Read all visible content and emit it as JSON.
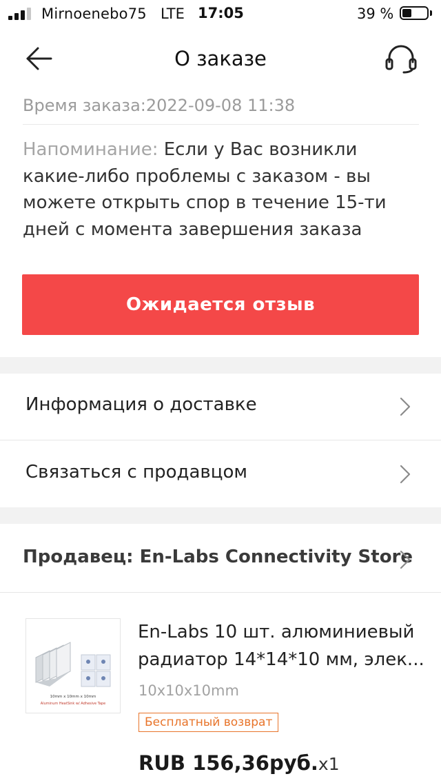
{
  "status_bar": {
    "carrier": "Mirnoenebo75",
    "network": "LTE",
    "time": "17:05",
    "battery_percent": "39 %",
    "battery_level": 0.39,
    "signal_bars_active": 3,
    "signal_bars_total": 4
  },
  "header": {
    "title": "О заказе",
    "back_icon": "arrow-left-icon",
    "support_icon": "headset-icon"
  },
  "order": {
    "time_text": "Время заказа:2022-09-08 11:38",
    "reminder_label": "Напоминание: ",
    "reminder_lines": [
      "Если у Вас возникли",
      "какие-либо проблемы с заказом - вы",
      "можете открыть спор в течение 15-ти",
      "дней с момента завершения заказа"
    ],
    "status_button_label": "Ожидается отзыв"
  },
  "menu": {
    "delivery_info": "Информация о доставке",
    "contact_seller": "Связаться с продавцом"
  },
  "seller": {
    "label": "Продавец: En-Labs Connectivity Store"
  },
  "product": {
    "title_line1": "En-Labs 10 шт. алюминиевый",
    "title_line2": "радиатор 14*14*10 мм, элек...",
    "variant": "10x10x10mm",
    "badge": "Бесплатный возврат",
    "price": "RUB 156,36руб.",
    "quantity": "x1",
    "thumb_caption_line1": "10mm x 10mm x 10mm",
    "thumb_caption_line2": "Aluminum HeatSink w/ Adhesive Tape"
  },
  "colors": {
    "accent_red": "#f44848",
    "badge_orange": "#e8742a",
    "muted_text": "#9b9b9b",
    "band_gray": "#f2f2f2"
  }
}
